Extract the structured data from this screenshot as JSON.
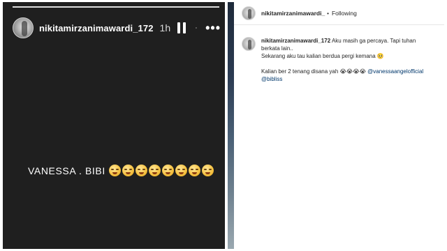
{
  "story": {
    "username": "nikitamirzanimawardi_172",
    "time": "1h",
    "caption": "VANESSA . BIBI",
    "emoji_count": 8,
    "icons": [
      "pause-icon",
      "mute-icon",
      "more-icon"
    ]
  },
  "post": {
    "header_username": "nikitamirzanimawardi_",
    "dot": "•",
    "following": "Following",
    "comment": {
      "username": "nikitamirzanimawardi_172",
      "line1": "Aku masih ga percaya. Tapi tuhan berkata lain..",
      "line2": "Sekarang aku tau kalian berdua pergi kemana 🥺",
      "line3_prefix": "Kalian ber 2 tenang disana yah 😭😭😭😭",
      "mention1": "@vanessaangelofficial",
      "mention2": "@bibliss"
    }
  },
  "colors": {
    "story_bg": "#1f1f1f",
    "text_dark": "#262626",
    "mention": "#00376b"
  }
}
